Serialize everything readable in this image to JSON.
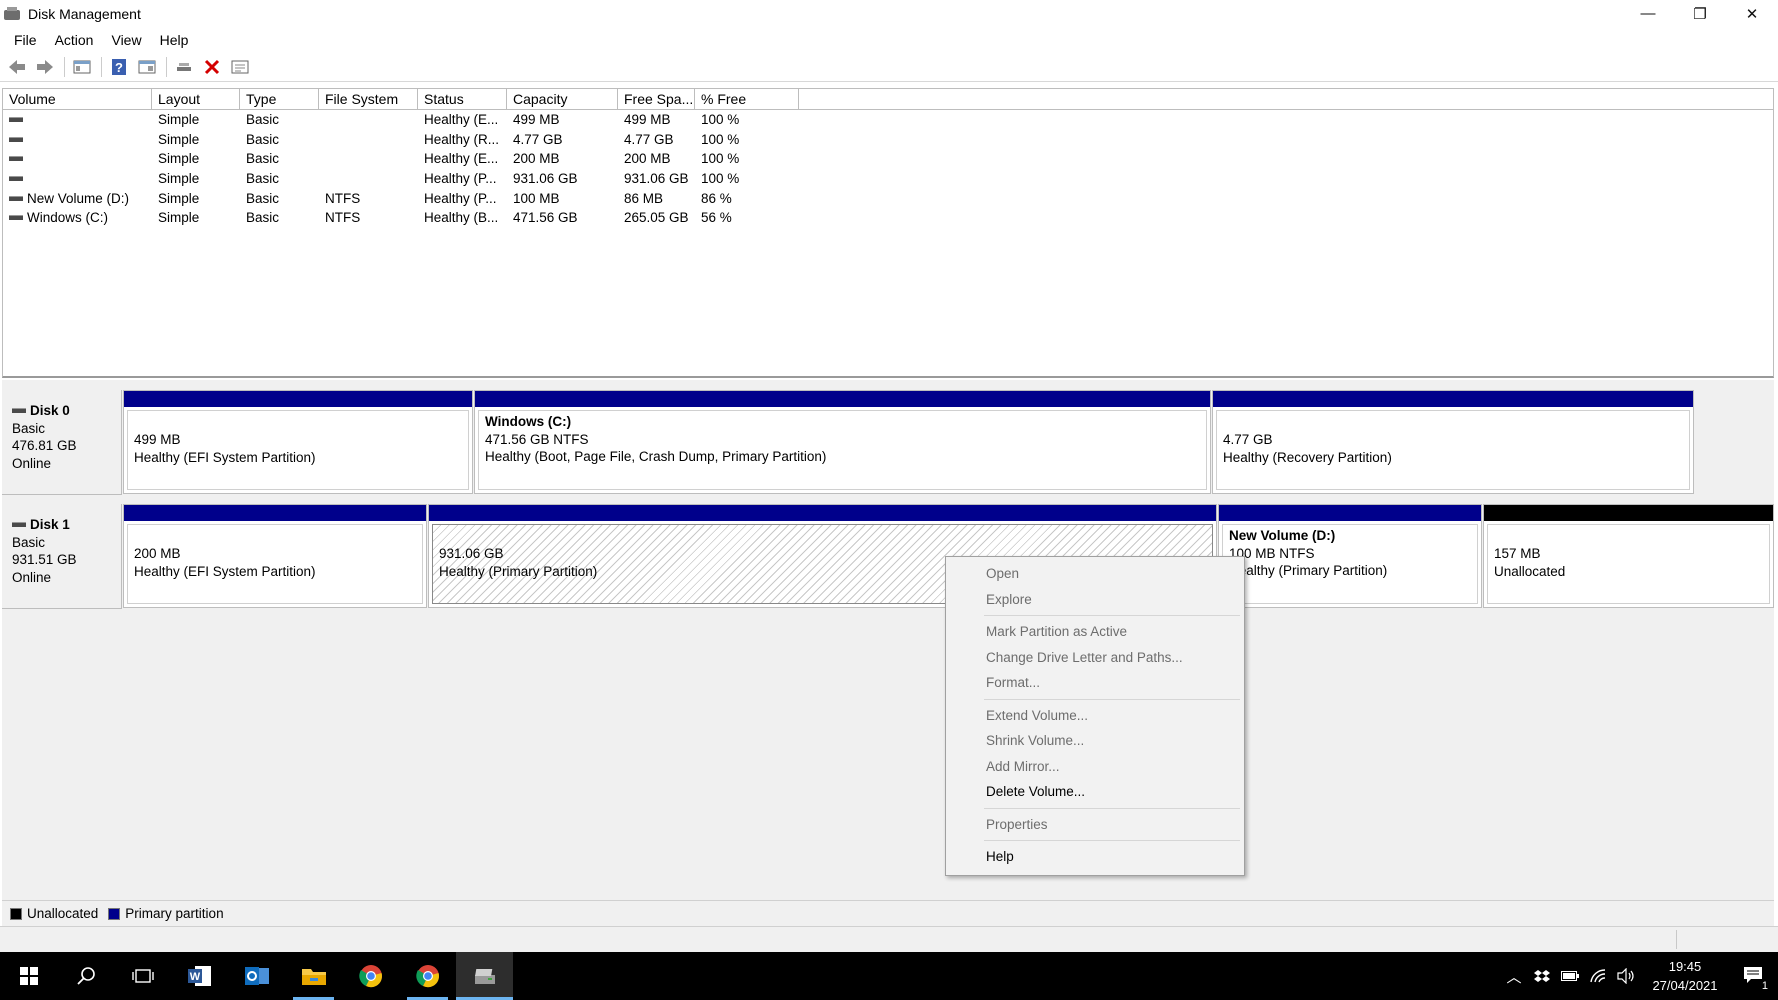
{
  "window": {
    "title": "Disk Management",
    "minimize": "—",
    "restore": "❐",
    "close": "✕"
  },
  "menu": [
    "File",
    "Action",
    "View",
    "Help"
  ],
  "toolbar": [
    "back-icon",
    "forward-icon",
    "console-tree-icon",
    "help-icon",
    "properties-icon",
    "connect-icon",
    "delete-icon",
    "details-icon"
  ],
  "volume_list": {
    "columns": [
      "Volume",
      "Layout",
      "Type",
      "File System",
      "Status",
      "Capacity",
      "Free Spa...",
      "% Free"
    ],
    "rows": [
      {
        "volume": "",
        "layout": "Simple",
        "type": "Basic",
        "fs": "",
        "status": "Healthy (E...",
        "capacity": "499 MB",
        "free": "499 MB",
        "pct": "100 %"
      },
      {
        "volume": "",
        "layout": "Simple",
        "type": "Basic",
        "fs": "",
        "status": "Healthy (R...",
        "capacity": "4.77 GB",
        "free": "4.77 GB",
        "pct": "100 %"
      },
      {
        "volume": "",
        "layout": "Simple",
        "type": "Basic",
        "fs": "",
        "status": "Healthy (E...",
        "capacity": "200 MB",
        "free": "200 MB",
        "pct": "100 %"
      },
      {
        "volume": "",
        "layout": "Simple",
        "type": "Basic",
        "fs": "",
        "status": "Healthy (P...",
        "capacity": "931.06 GB",
        "free": "931.06 GB",
        "pct": "100 %"
      },
      {
        "volume": "New Volume (D:)",
        "layout": "Simple",
        "type": "Basic",
        "fs": "NTFS",
        "status": "Healthy (P...",
        "capacity": "100 MB",
        "free": "86 MB",
        "pct": "86 %"
      },
      {
        "volume": "Windows (C:)",
        "layout": "Simple",
        "type": "Basic",
        "fs": "NTFS",
        "status": "Healthy (B...",
        "capacity": "471.56 GB",
        "free": "265.05 GB",
        "pct": "56 %"
      }
    ]
  },
  "disks": [
    {
      "name": "Disk 0",
      "kind": "Basic",
      "size": "476.81 GB",
      "state": "Online",
      "partitions": [
        {
          "name": "",
          "size": "499 MB",
          "status": "Healthy (EFI System Partition)"
        },
        {
          "name": "Windows  (C:)",
          "size": "471.56 GB NTFS",
          "status": "Healthy (Boot, Page File, Crash Dump, Primary Partition)"
        },
        {
          "name": "",
          "size": "4.77 GB",
          "status": "Healthy (Recovery Partition)"
        }
      ]
    },
    {
      "name": "Disk 1",
      "kind": "Basic",
      "size": "931.51 GB",
      "state": "Online",
      "partitions": [
        {
          "name": "",
          "size": "200 MB",
          "status": "Healthy (EFI System Partition)"
        },
        {
          "name": "",
          "size": "931.06 GB",
          "status": "Healthy (Primary Partition)"
        },
        {
          "name": "New Volume  (D:)",
          "size": "100 MB NTFS",
          "status": "Healthy (Primary Partition)"
        },
        {
          "name": "",
          "size": "157 MB",
          "status": "Unallocated"
        }
      ]
    }
  ],
  "legend": [
    {
      "label": "Unallocated",
      "color": "#000000"
    },
    {
      "label": "Primary partition",
      "color": "#00008b"
    }
  ],
  "context_menu": [
    {
      "label": "Open",
      "enabled": false
    },
    {
      "label": "Explore",
      "enabled": false
    },
    {
      "label": "Mark Partition as Active",
      "enabled": false
    },
    {
      "label": "Change Drive Letter and Paths...",
      "enabled": false
    },
    {
      "label": "Format...",
      "enabled": false
    },
    {
      "label": "Extend Volume...",
      "enabled": false
    },
    {
      "label": "Shrink Volume...",
      "enabled": false
    },
    {
      "label": "Add Mirror...",
      "enabled": false
    },
    {
      "label": "Delete Volume...",
      "enabled": true
    },
    {
      "label": "Properties",
      "enabled": false
    },
    {
      "label": "Help",
      "enabled": true
    }
  ],
  "taskbar": {
    "apps": [
      "start-icon",
      "search-icon",
      "task-view-icon",
      "word-icon",
      "outlook-icon",
      "file-explorer-icon",
      "chrome-icon",
      "chrome-icon",
      "disk-management-icon"
    ],
    "clock_time": "19:45",
    "clock_date": "27/04/2021",
    "notification_count": "1"
  },
  "colors": {
    "primary_partition": "#00008b",
    "unallocated": "#000000",
    "taskbar": "#000000"
  }
}
